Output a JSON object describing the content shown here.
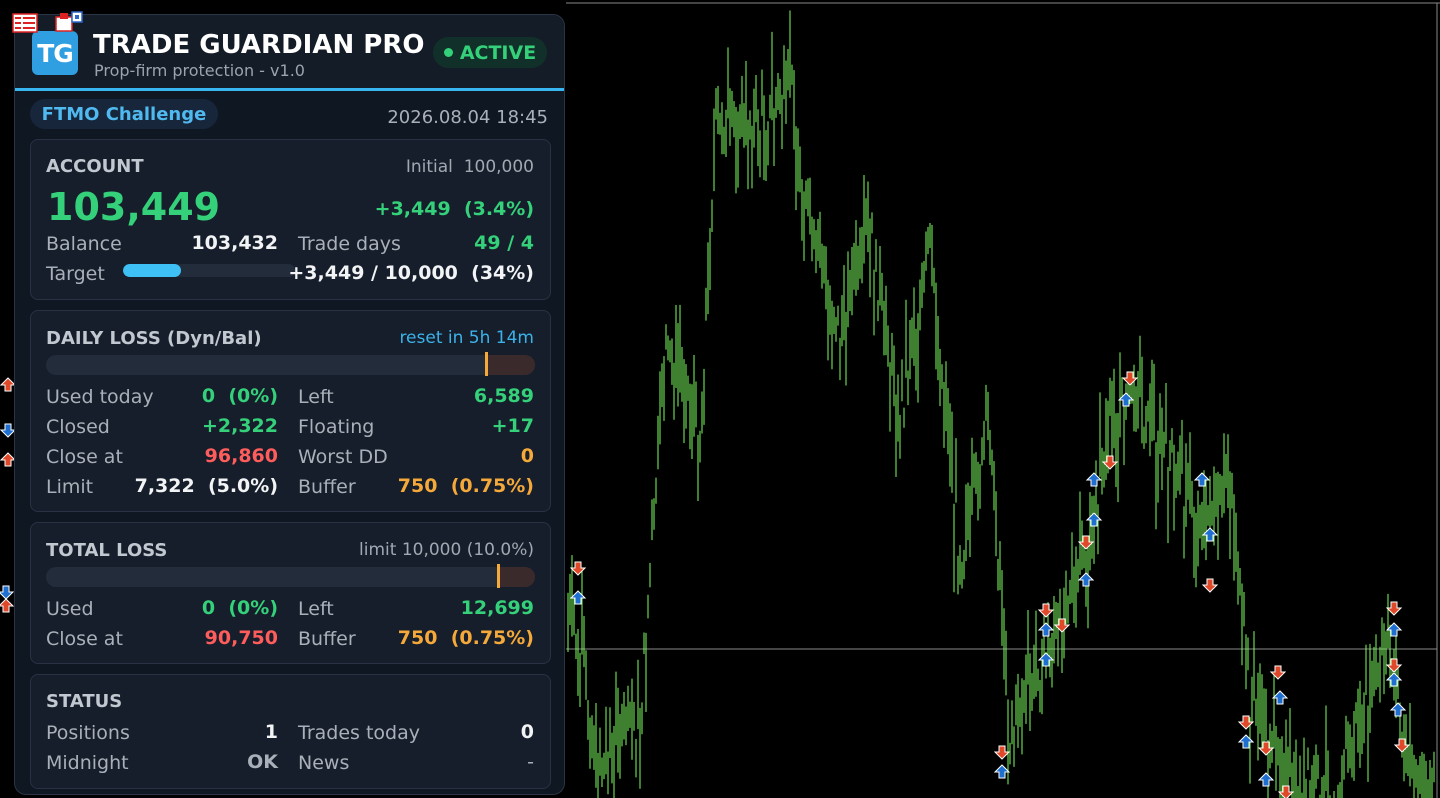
{
  "header": {
    "logo": "TG",
    "title": "TRADE GUARDIAN PRO",
    "subtitle": "Prop-firm protection  -  v1.0",
    "status": "ACTIVE"
  },
  "challenge": {
    "label": "FTMO Challenge",
    "datetime": "2026.08.04 18:45"
  },
  "account": {
    "title": "ACCOUNT",
    "initial_label": "Initial",
    "initial": "100,000",
    "equity": "103,449",
    "pnl": "+3,449",
    "pnl_pct": "(3.4%)",
    "balance_label": "Balance",
    "balance": "103,432",
    "trade_days_label": "Trade days",
    "trade_days": "49 / 4",
    "target_label": "Target",
    "target_progress": 0.34,
    "target_value": "+3,449 / 10,000",
    "target_pct": "(34%)"
  },
  "daily_loss": {
    "title": "DAILY LOSS  (Dyn/Bal)",
    "reset": "reset in 5h 14m",
    "bar_used_fraction": 0.0,
    "bar_buffer_fraction": 0.1,
    "used_today_label": "Used today",
    "used_today": "0",
    "used_today_pct": "(0%)",
    "left_label": "Left",
    "left": "6,589",
    "closed_label": "Closed",
    "closed": "+2,322",
    "floating_label": "Floating",
    "floating": "+17",
    "close_at_label": "Close at",
    "close_at": "96,860",
    "worst_dd_label": "Worst DD",
    "worst_dd": "0",
    "limit_label": "Limit",
    "limit": "7,322",
    "limit_pct": "(5.0%)",
    "buffer_label": "Buffer",
    "buffer": "750",
    "buffer_pct": "(0.75%)"
  },
  "total_loss": {
    "title": "TOTAL LOSS",
    "limit_info": "limit 10,000  (10.0%)",
    "bar_buffer_fraction": 0.075,
    "used_label": "Used",
    "used": "0",
    "used_pct": "(0%)",
    "left_label": "Left",
    "left": "12,699",
    "close_at_label": "Close at",
    "close_at": "90,750",
    "buffer_label": "Buffer",
    "buffer": "750",
    "buffer_pct": "(0.75%)"
  },
  "status": {
    "title": "STATUS",
    "positions_label": "Positions",
    "positions": "1",
    "trades_today_label": "Trades today",
    "trades_today": "0",
    "midnight_label": "Midnight",
    "midnight": "OK",
    "news_label": "News",
    "news": "-"
  },
  "colors": {
    "accent": "#38b6f0",
    "positive": "#35d17a",
    "negative": "#ff5c5c",
    "warning": "#f4a93a",
    "candle": "#7dff5e",
    "buy_arrow": "#1e6fd0",
    "sell_arrow": "#e0482a"
  },
  "icons": {
    "toolbar": [
      "list-icon",
      "tester-icon"
    ]
  }
}
